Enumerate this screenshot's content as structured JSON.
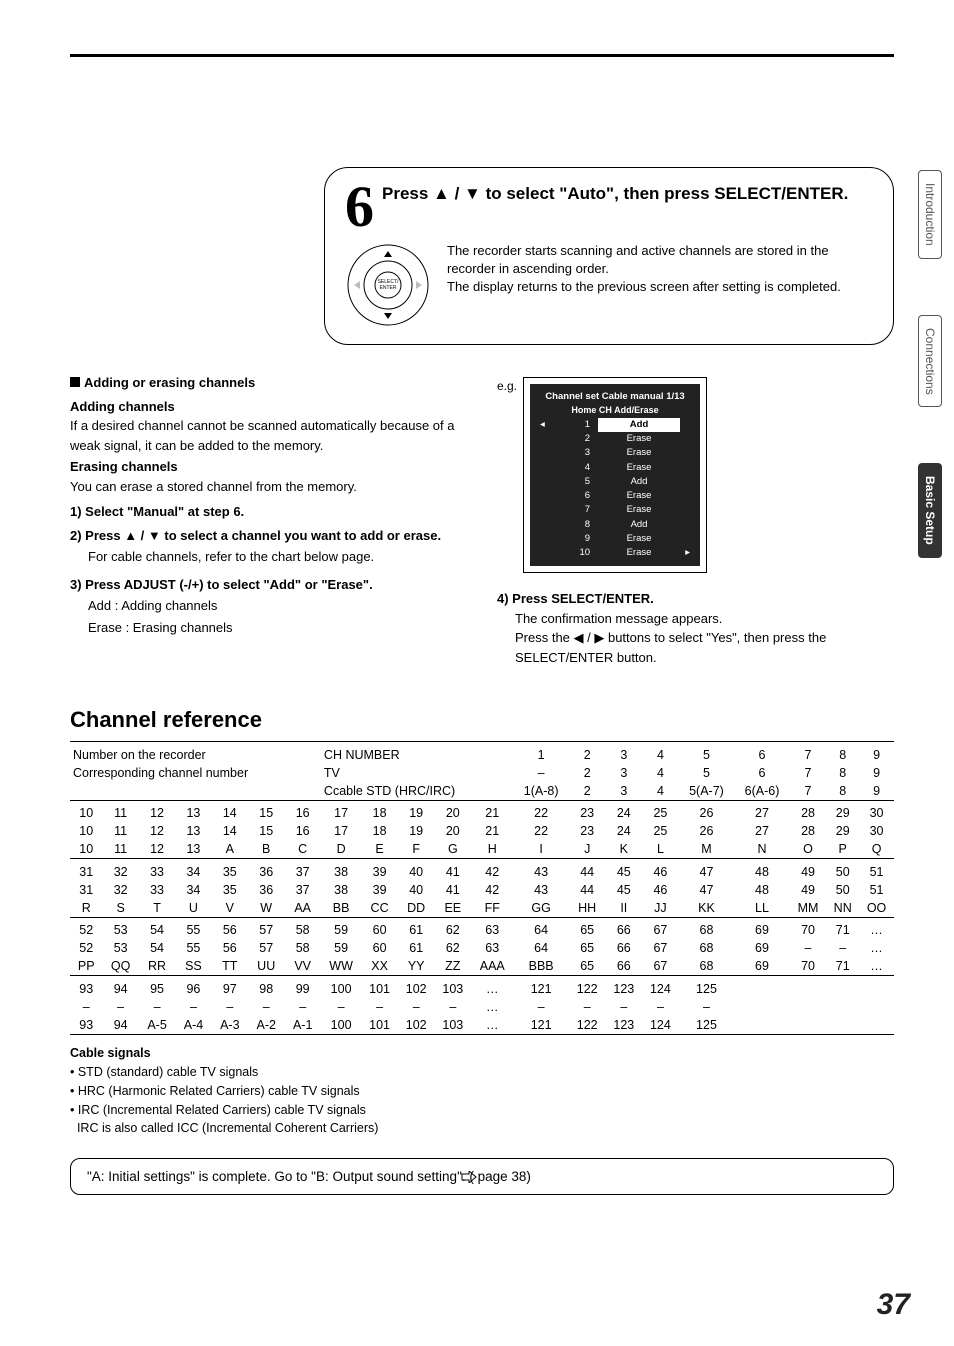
{
  "step": {
    "number": "6",
    "title": "Press ▲ / ▼ to select \"Auto\", then press SELECT/ENTER.",
    "desc1": "The recorder starts scanning and active channels are stored in the recorder in ascending order.",
    "desc2": "The display returns to the previous screen after setting is completed.",
    "remote_label": "SELECT/\nENTER"
  },
  "adding": {
    "heading": "Adding or erasing channels",
    "add_h": "Adding channels",
    "add_t": "If a desired channel cannot be scanned automatically because of a weak signal, it can be added to the memory.",
    "erase_h": "Erasing channels",
    "erase_t": "You can erase a stored channel from the memory.",
    "s1_b": "1)  Select \"Manual\" at step 6.",
    "s2_b": "2)  Press ▲ / ▼ to select a channel you want to add or erase.",
    "s2_t": "For cable channels, refer to the chart below page.",
    "s3_b": "3)  Press ADJUST (-/+) to select \"Add\" or \"Erase\".",
    "s3_a": "Add :     Adding channels",
    "s3_e": "Erase :  Erasing channels",
    "s4_b": "4)  Press SELECT/ENTER.",
    "s4_t1": "The confirmation message appears.",
    "s4_t2": "Press the ◀ / ▶ buttons to select \"Yes\", then press the SELECT/ENTER button."
  },
  "osd": {
    "eg": "e.g.",
    "title": "Channel set Cable manual  1/13",
    "cols": "Home CH   Add/Erase",
    "rows": [
      {
        "ch": "1",
        "ae": "Add",
        "sel": true
      },
      {
        "ch": "2",
        "ae": "Erase"
      },
      {
        "ch": "3",
        "ae": "Erase"
      },
      {
        "ch": "4",
        "ae": "Erase"
      },
      {
        "ch": "5",
        "ae": "Add"
      },
      {
        "ch": "6",
        "ae": "Erase"
      },
      {
        "ch": "7",
        "ae": "Erase"
      },
      {
        "ch": "8",
        "ae": "Add"
      },
      {
        "ch": "9",
        "ae": "Erase"
      },
      {
        "ch": "10",
        "ae": "Erase"
      }
    ]
  },
  "ref": {
    "title": "Channel reference",
    "h_num": "Number on the recorder",
    "h_corr": "Corresponding channel number",
    "h_ch": "CH NUMBER",
    "h_tv": "TV",
    "h_cable": "Ccable STD (HRC/IRC)",
    "topcols1": [
      "1",
      "2",
      "3",
      "4",
      "5",
      "6",
      "7",
      "8",
      "9"
    ],
    "topcols2": [
      "–",
      "2",
      "3",
      "4",
      "5",
      "6",
      "7",
      "8",
      "9"
    ],
    "topcols3": [
      "1(A-8)",
      "2",
      "3",
      "4",
      "5(A-7)",
      "6(A-6)",
      "7",
      "8",
      "9"
    ],
    "block1": {
      "r1": [
        "10",
        "11",
        "12",
        "13",
        "14",
        "15",
        "16",
        "17",
        "18",
        "19",
        "20",
        "21",
        "22",
        "23",
        "24",
        "25",
        "26",
        "27",
        "28",
        "29",
        "30"
      ],
      "r2": [
        "10",
        "11",
        "12",
        "13",
        "14",
        "15",
        "16",
        "17",
        "18",
        "19",
        "20",
        "21",
        "22",
        "23",
        "24",
        "25",
        "26",
        "27",
        "28",
        "29",
        "30"
      ],
      "r3": [
        "10",
        "11",
        "12",
        "13",
        "A",
        "B",
        "C",
        "D",
        "E",
        "F",
        "G",
        "H",
        "I",
        "J",
        "K",
        "L",
        "M",
        "N",
        "O",
        "P",
        "Q"
      ]
    },
    "block2": {
      "r1": [
        "31",
        "32",
        "33",
        "34",
        "35",
        "36",
        "37",
        "38",
        "39",
        "40",
        "41",
        "42",
        "43",
        "44",
        "45",
        "46",
        "47",
        "48",
        "49",
        "50",
        "51"
      ],
      "r2": [
        "31",
        "32",
        "33",
        "34",
        "35",
        "36",
        "37",
        "38",
        "39",
        "40",
        "41",
        "42",
        "43",
        "44",
        "45",
        "46",
        "47",
        "48",
        "49",
        "50",
        "51"
      ],
      "r3": [
        "R",
        "S",
        "T",
        "U",
        "V",
        "W",
        "AA",
        "BB",
        "CC",
        "DD",
        "EE",
        "FF",
        "GG",
        "HH",
        "II",
        "JJ",
        "KK",
        "LL",
        "MM",
        "NN",
        "OO"
      ]
    },
    "block3": {
      "r1": [
        "52",
        "53",
        "54",
        "55",
        "56",
        "57",
        "58",
        "59",
        "60",
        "61",
        "62",
        "63",
        "64",
        "65",
        "66",
        "67",
        "68",
        "69",
        "70",
        "71",
        "…"
      ],
      "r2": [
        "52",
        "53",
        "54",
        "55",
        "56",
        "57",
        "58",
        "59",
        "60",
        "61",
        "62",
        "63",
        "64",
        "65",
        "66",
        "67",
        "68",
        "69",
        "–",
        "–",
        "…"
      ],
      "r3": [
        "PP",
        "QQ",
        "RR",
        "SS",
        "TT",
        "UU",
        "VV",
        "WW",
        "XX",
        "YY",
        "ZZ",
        "AAA",
        "BBB",
        "65",
        "66",
        "67",
        "68",
        "69",
        "70",
        "71",
        "…"
      ]
    },
    "block4": {
      "r1": [
        "93",
        "94",
        "95",
        "96",
        "97",
        "98",
        "99",
        "100",
        "101",
        "102",
        "103",
        "…",
        "121",
        "122",
        "123",
        "124",
        "125",
        "",
        "",
        "",
        ""
      ],
      "r2": [
        "–",
        "–",
        "–",
        "–",
        "–",
        "–",
        "–",
        "–",
        "–",
        "–",
        "–",
        "…",
        "–",
        "–",
        "–",
        "–",
        "–",
        "",
        "",
        "",
        ""
      ],
      "r3": [
        "93",
        "94",
        "A-5",
        "A-4",
        "A-3",
        "A-2",
        "A-1",
        "100",
        "101",
        "102",
        "103",
        "…",
        "121",
        "122",
        "123",
        "124",
        "125",
        "",
        "",
        "",
        ""
      ]
    }
  },
  "foot": {
    "h": "Cable signals",
    "l1": "• STD (standard) cable TV signals",
    "l2": "• HRC (Harmonic Related Carriers) cable TV signals",
    "l3": "• IRC (Incremental Related Carriers) cable TV signals",
    "l4": "  IRC is also called ICC (Incremental Coherent Carriers)"
  },
  "complete": "\"A: Initial settings\" is complete. Go to \"B: Output sound setting\". (    page 38)",
  "tabs": {
    "t1": "Introduction",
    "t2": "Connections",
    "t3": "Basic Setup"
  },
  "page_number": "37"
}
